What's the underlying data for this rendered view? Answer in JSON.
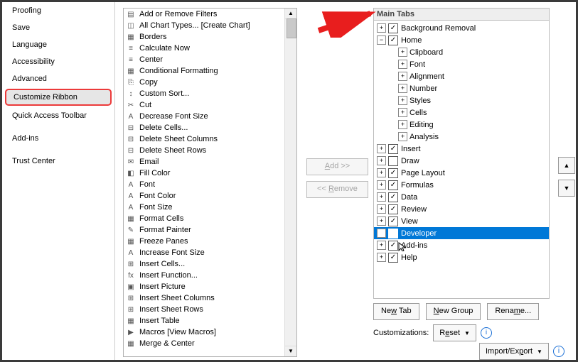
{
  "sidebar": {
    "items": [
      {
        "label": "Proofing"
      },
      {
        "label": "Save"
      },
      {
        "label": "Language"
      },
      {
        "label": "Accessibility"
      },
      {
        "label": "Advanced"
      },
      {
        "label": "Customize Ribbon",
        "selected": true
      },
      {
        "label": "Quick Access Toolbar"
      },
      {
        "label": "Add-ins"
      },
      {
        "label": "Trust Center"
      }
    ]
  },
  "commands": [
    {
      "label": "Add or Remove Filters"
    },
    {
      "label": "All Chart Types... [Create Chart]"
    },
    {
      "label": "Borders",
      "sub": "|"
    },
    {
      "label": "Calculate Now"
    },
    {
      "label": "Center"
    },
    {
      "label": "Conditional Formatting",
      "sub": true
    },
    {
      "label": "Copy"
    },
    {
      "label": "Custom Sort..."
    },
    {
      "label": "Cut"
    },
    {
      "label": "Decrease Font Size"
    },
    {
      "label": "Delete Cells..."
    },
    {
      "label": "Delete Sheet Columns"
    },
    {
      "label": "Delete Sheet Rows"
    },
    {
      "label": "Email"
    },
    {
      "label": "Fill Color",
      "sub": true
    },
    {
      "label": "Font",
      "sub": "I"
    },
    {
      "label": "Font Color",
      "sub": true
    },
    {
      "label": "Font Size",
      "sub": "I"
    },
    {
      "label": "Format Cells"
    },
    {
      "label": "Format Painter"
    },
    {
      "label": "Freeze Panes",
      "sub": true
    },
    {
      "label": "Increase Font Size"
    },
    {
      "label": "Insert Cells..."
    },
    {
      "label": "Insert Function..."
    },
    {
      "label": "Insert Picture"
    },
    {
      "label": "Insert Sheet Columns"
    },
    {
      "label": "Insert Sheet Rows"
    },
    {
      "label": "Insert Table"
    },
    {
      "label": "Macros [View Macros]",
      "sub": true
    },
    {
      "label": "Merge & Center",
      "sub": true
    }
  ],
  "center_buttons": {
    "add": "Add >>",
    "remove": "<< Remove"
  },
  "right": {
    "header": "Main Tabs",
    "tabs": [
      {
        "label": "Background Removal",
        "checked": true,
        "exp": "+",
        "level": 1
      },
      {
        "label": "Home",
        "checked": true,
        "exp": "−",
        "level": 1
      },
      {
        "label": "Clipboard",
        "exp": "+",
        "level": 2
      },
      {
        "label": "Font",
        "exp": "+",
        "level": 2
      },
      {
        "label": "Alignment",
        "exp": "+",
        "level": 2
      },
      {
        "label": "Number",
        "exp": "+",
        "level": 2
      },
      {
        "label": "Styles",
        "exp": "+",
        "level": 2
      },
      {
        "label": "Cells",
        "exp": "+",
        "level": 2
      },
      {
        "label": "Editing",
        "exp": "+",
        "level": 2
      },
      {
        "label": "Analysis",
        "exp": "+",
        "level": 2
      },
      {
        "label": "Insert",
        "checked": true,
        "exp": "+",
        "level": 1
      },
      {
        "label": "Draw",
        "checked": false,
        "exp": "+",
        "level": 1
      },
      {
        "label": "Page Layout",
        "checked": true,
        "exp": "+",
        "level": 1
      },
      {
        "label": "Formulas",
        "checked": true,
        "exp": "+",
        "level": 1
      },
      {
        "label": "Data",
        "checked": true,
        "exp": "+",
        "level": 1
      },
      {
        "label": "Review",
        "checked": true,
        "exp": "+",
        "level": 1
      },
      {
        "label": "View",
        "checked": true,
        "exp": "+",
        "level": 1
      },
      {
        "label": "Developer",
        "checked": true,
        "exp": "+",
        "level": 1,
        "selected": true
      },
      {
        "label": "Add-ins",
        "checked": true,
        "exp": "+",
        "level": 1,
        "cursor": true
      },
      {
        "label": "Help",
        "checked": true,
        "exp": "+",
        "level": 1
      }
    ]
  },
  "bottom": {
    "new_tab": "New Tab",
    "new_group": "New Group",
    "rename": "Rename...",
    "customizations_label": "Customizations:",
    "reset": "Reset",
    "import_export": "Import/Export"
  },
  "move": {
    "up": "▲",
    "down": "▼"
  }
}
